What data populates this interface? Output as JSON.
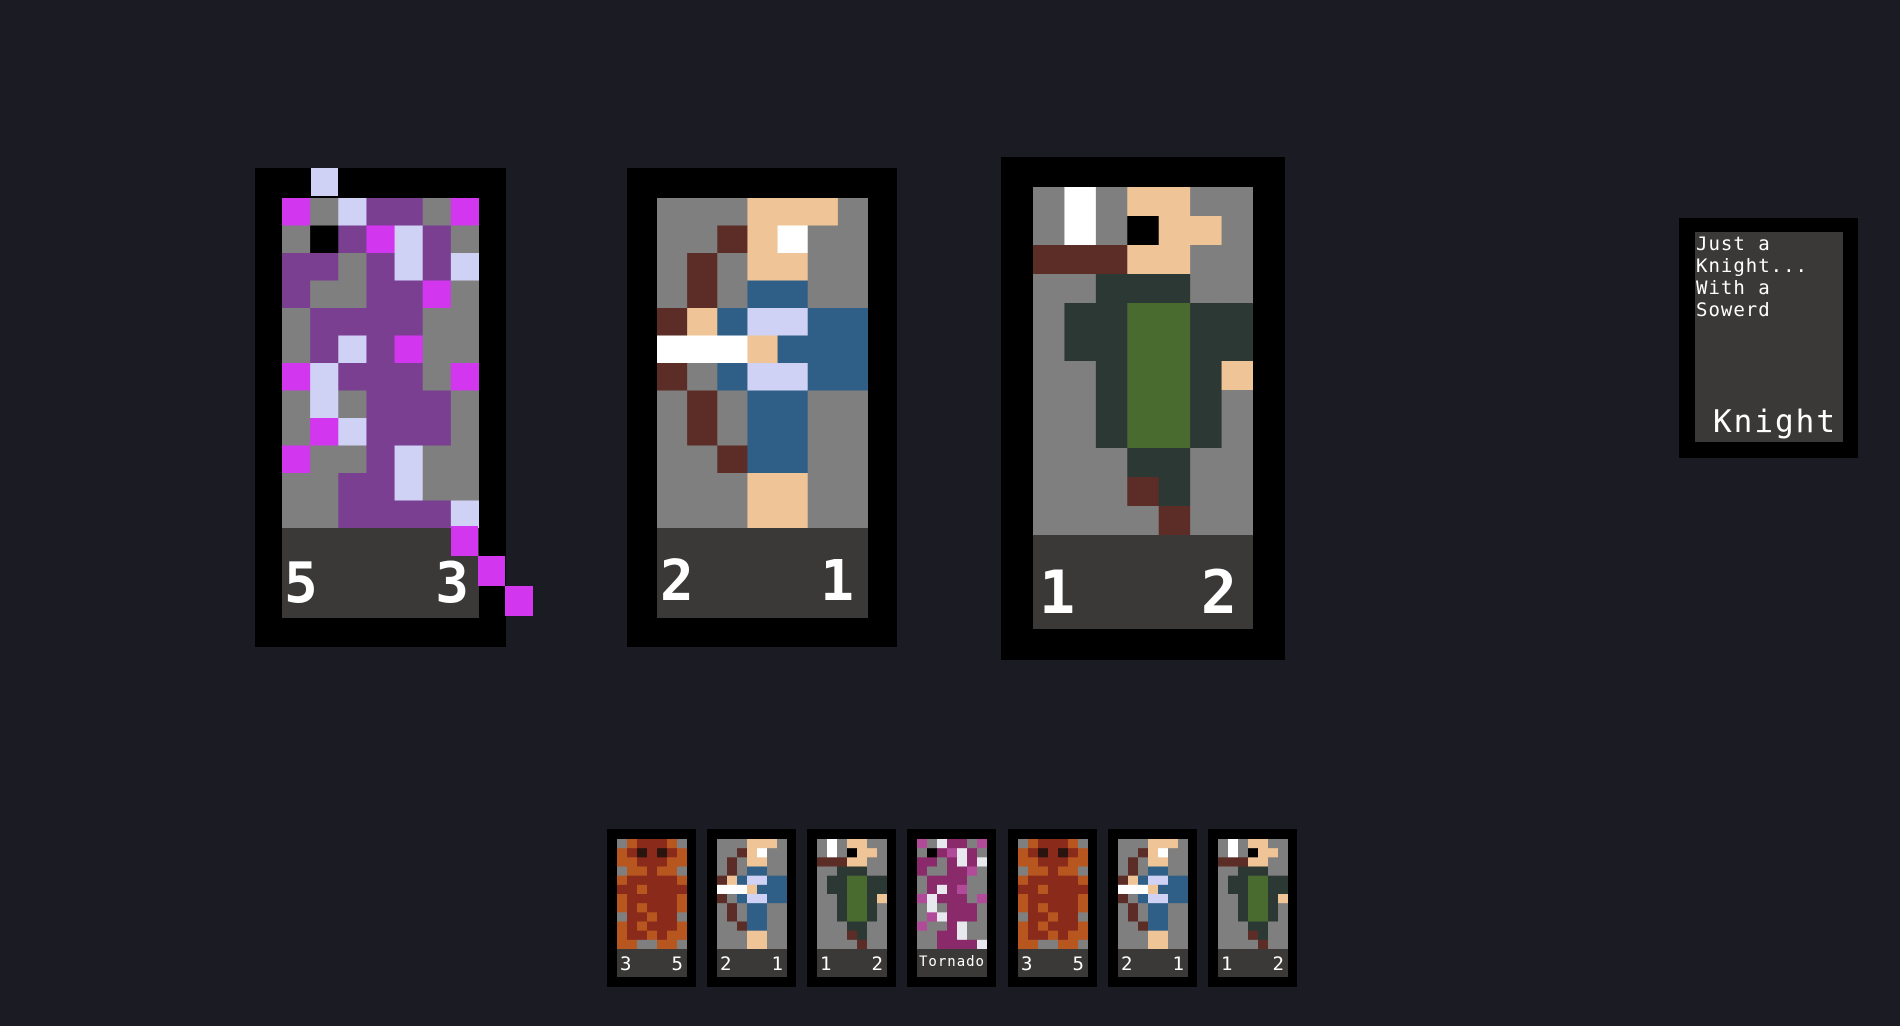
{
  "board": [
    {
      "id": "tornado",
      "atk": "5",
      "def": "3",
      "palette": [
        "#7f7f7f",
        "#7a3f91",
        "#cfd1f5",
        "#d236ef",
        "#000000"
      ]
    },
    {
      "id": "archer",
      "atk": "2",
      "def": "1",
      "palette": [
        "#7f7f7f",
        "#5b2d26",
        "#efc497",
        "#2f5f86",
        "#cfd1f5",
        "#ffffff"
      ]
    },
    {
      "id": "knight",
      "atk": "1",
      "def": "2",
      "palette": [
        "#7f7f7f",
        "#ffffff",
        "#5b2d26",
        "#efc497",
        "#2c3833",
        "#4a6b2f",
        "#000000"
      ]
    }
  ],
  "info_card": {
    "description": "Just a\nKnight...\nWith a\nSowerd",
    "name": "Knight"
  },
  "hand": [
    {
      "id": "bear",
      "atk": "3",
      "def": "5"
    },
    {
      "id": "archer",
      "atk": "2",
      "def": "1"
    },
    {
      "id": "knight",
      "atk": "1",
      "def": "2"
    },
    {
      "id": "tornado",
      "name": "Tornado"
    },
    {
      "id": "bear",
      "atk": "3",
      "def": "5"
    },
    {
      "id": "archer",
      "atk": "2",
      "def": "1"
    },
    {
      "id": "knight",
      "atk": "1",
      "def": "2"
    }
  ]
}
